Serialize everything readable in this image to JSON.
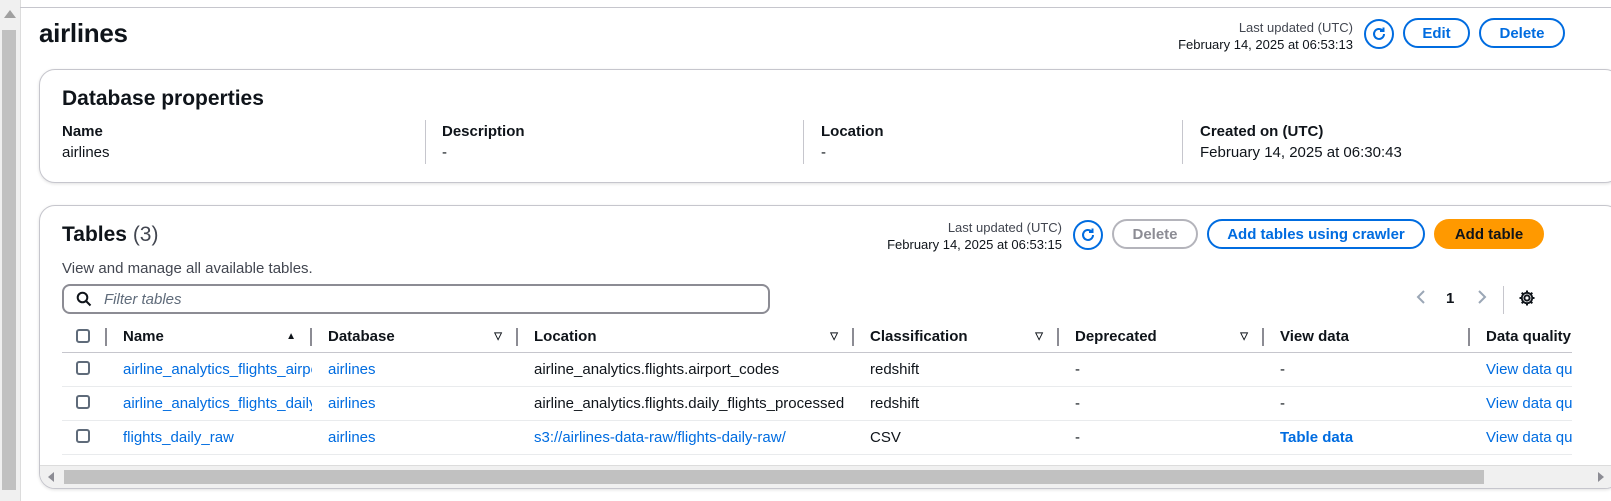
{
  "page": {
    "title": "airlines"
  },
  "header": {
    "last_updated_label": "Last updated (UTC)",
    "last_updated_value": "February 14, 2025 at 06:53:13",
    "edit_label": "Edit",
    "delete_label": "Delete"
  },
  "db_props": {
    "title": "Database properties",
    "items": [
      {
        "label": "Name",
        "value": "airlines"
      },
      {
        "label": "Description",
        "value": "-"
      },
      {
        "label": "Location",
        "value": "-"
      },
      {
        "label": "Created on (UTC)",
        "value": "February 14, 2025 at 06:30:43"
      }
    ]
  },
  "tables": {
    "title": "Tables",
    "count": "(3)",
    "description": "View and manage all available tables.",
    "last_updated_label": "Last updated (UTC)",
    "last_updated_value": "February 14, 2025 at 06:53:15",
    "delete_label": "Delete",
    "add_crawler_label": "Add tables using crawler",
    "add_table_label": "Add table",
    "filter_placeholder": "Filter tables",
    "page_number": "1",
    "columns": [
      "Name",
      "Database",
      "Location",
      "Classification",
      "Deprecated",
      "View data",
      "Data quality"
    ],
    "rows": [
      {
        "name": "airline_analytics_flights_airport_codes",
        "database": "airlines",
        "location": "airline_analytics.flights.airport_codes",
        "classification": "redshift",
        "deprecated": "-",
        "view_data": "-",
        "data_quality": "View data quality"
      },
      {
        "name": "airline_analytics_flights_daily_flights_processed",
        "database": "airlines",
        "location": "airline_analytics.flights.daily_flights_processed",
        "classification": "redshift",
        "deprecated": "-",
        "view_data": "-",
        "data_quality": "View data quality"
      },
      {
        "name": "flights_daily_raw",
        "database": "airlines",
        "location": "s3://airlines-data-raw/flights-daily-raw/",
        "classification": "CSV",
        "deprecated": "-",
        "view_data": "Table data",
        "data_quality": "View data quality"
      }
    ]
  },
  "colors": {
    "link": "#006ce0",
    "primary": "#ff9900",
    "border": "#c6c6cd"
  }
}
